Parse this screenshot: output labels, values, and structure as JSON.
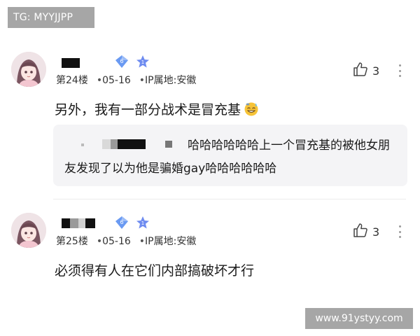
{
  "watermarks": {
    "top_left": "TG: MYYJJPP",
    "bottom_right": "www.91ystyy.com",
    "color": "#a6a6a6"
  },
  "comments": [
    {
      "floor": "第24楼",
      "date": "05-16",
      "ip": "IP属地:安徽",
      "likes": "3",
      "text": "另外，我有一部分战术是冒充基",
      "emoji": "sweat-smile-emoji",
      "quote": {
        "text": "哈哈哈哈哈哈上一个冒充基的被他女朋友发现了以为他是骗婚gay哈哈哈哈哈哈"
      },
      "badges": {
        "level": "6",
        "rank": "1"
      }
    },
    {
      "floor": "第25楼",
      "date": "05-16",
      "ip": "IP属地:安徽",
      "likes": "3",
      "text": "必须得有人在它们内部搞破坏才行",
      "badges": {
        "level": "6",
        "rank": "1"
      }
    }
  ],
  "icons": {
    "like": "thumbs-up-icon",
    "more": "more-vertical-icon",
    "level_badge": "diamond-badge-icon",
    "rank_badge": "star-badge-icon"
  },
  "colors": {
    "quote_bg": "#f4f4f6",
    "badge_blue": "#5a8ff0",
    "badge_star": "#6f8cf0"
  }
}
